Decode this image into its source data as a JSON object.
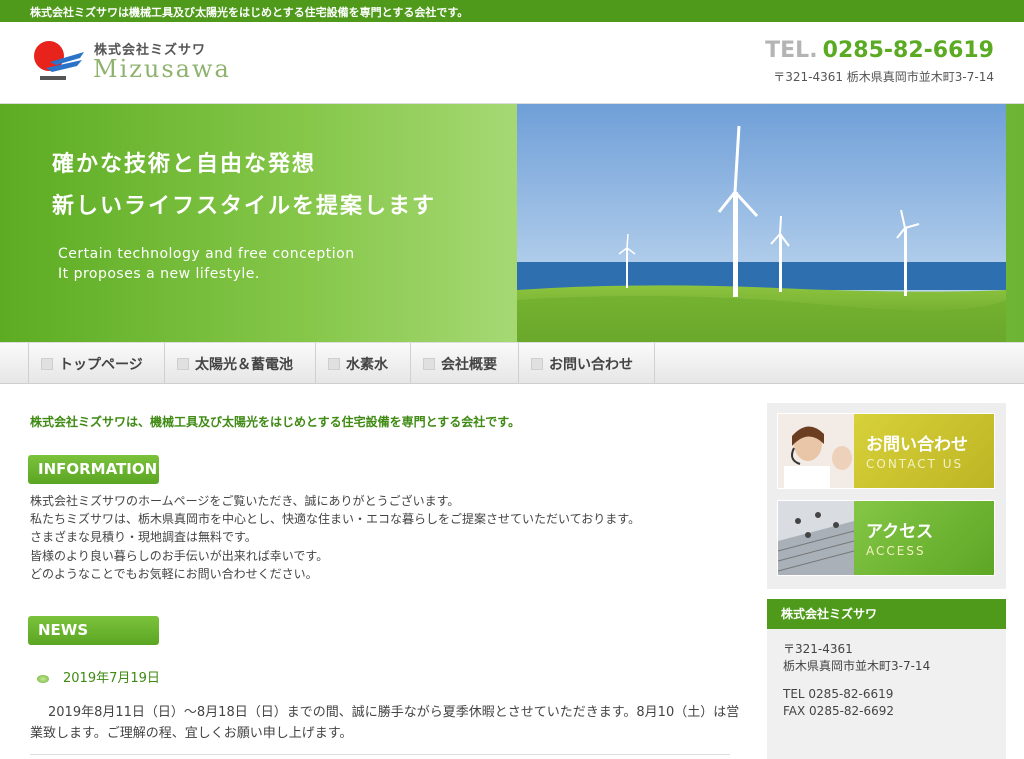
{
  "topbar": {
    "text": "株式会社ミズサワは機械工具及び太陽光をはじめとする住宅設備を専門とする会社です。"
  },
  "header": {
    "logo_sub": "株式会社ミズサワ",
    "logo_main": "Mizusawa",
    "tel_label": "TEL.",
    "tel_number": "0285-82-6619",
    "address": "〒321-4361 栃木県真岡市並木町3-7-14"
  },
  "hero": {
    "copy_line1": "確かな技術と自由な発想",
    "copy_line2": "新しいライフスタイルを提案します",
    "en_line1": "Certain technology and free conception",
    "en_line2": "It proposes a new lifestyle."
  },
  "nav": {
    "items": [
      {
        "label": "トップページ"
      },
      {
        "label": "太陽光＆蓄電池"
      },
      {
        "label": "水素水"
      },
      {
        "label": "会社概要"
      },
      {
        "label": "お問い合わせ"
      }
    ]
  },
  "main": {
    "lead": "株式会社ミズサワは、機械工具及び太陽光をはじめとする住宅設備を専門とする会社です。",
    "info_title": "INFORMATION",
    "info_lines": [
      "株式会社ミズサワのホームページをご覧いただき、誠にありがとうございます。",
      "私たちミズサワは、栃木県真岡市を中心とし、快適な住まい・エコな暮らしをご提案させていただいております。",
      "さまざまな見積り・現地調査は無料です。",
      "皆様のより良い暮らしのお手伝いが出来れば幸いです。",
      "どのようなことでもお気軽にお問い合わせください。"
    ],
    "news_title": "NEWS",
    "news": [
      {
        "date": "2019年7月19日",
        "body": "2019年8月11日（日）〜8月18日（日）までの間、誠に勝手ながら夏季休暇とさせていただきます。8月10（土）は営業致します。ご理解の程、宜しくお願い申し上げます。"
      }
    ]
  },
  "sidebar": {
    "contact_jp": "お問い合わせ",
    "contact_en": "CONTACT US",
    "access_jp": "アクセス",
    "access_en": "ACCESS",
    "company_name": "株式会社ミズサワ",
    "postal": "〒321-4361",
    "address": "栃木県真岡市並木町3-7-14",
    "tel": "TEL 0285-82-6619",
    "fax": "FAX 0285-82-6692"
  },
  "colors": {
    "brand_green": "#4f9a1a",
    "accent_green": "#5aaa22",
    "contact_banner": "#c9c227",
    "access_banner": "#6db433"
  }
}
